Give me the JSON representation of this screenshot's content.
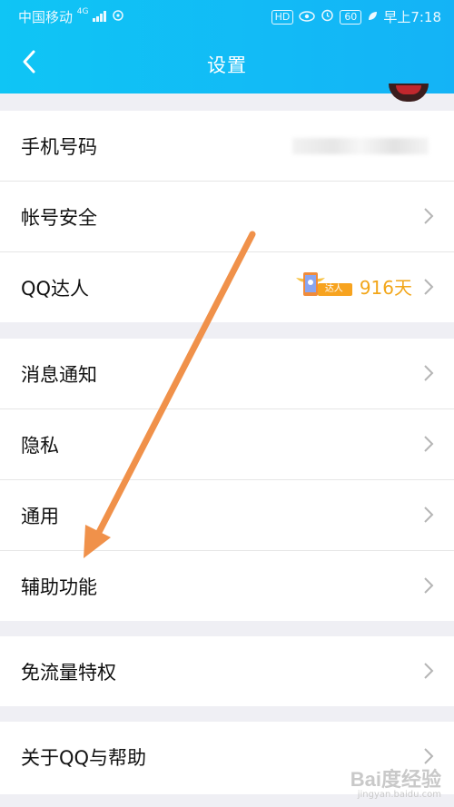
{
  "statusbar": {
    "carrier": "中国移动",
    "network": "4G",
    "hd": "HD",
    "battery": "60",
    "time": "早上7:18"
  },
  "header": {
    "title": "设置"
  },
  "group1": {
    "items": [
      {
        "label": "手机号码"
      },
      {
        "label": "帐号安全"
      },
      {
        "label": "QQ达人",
        "badge_text": "达人",
        "days": "916天"
      }
    ]
  },
  "group2": {
    "items": [
      {
        "label": "消息通知"
      },
      {
        "label": "隐私"
      },
      {
        "label": "通用"
      },
      {
        "label": "辅助功能"
      }
    ]
  },
  "group3": {
    "items": [
      {
        "label": "免流量特权"
      }
    ]
  },
  "group4": {
    "items": [
      {
        "label": "关于QQ与帮助"
      }
    ]
  },
  "watermark": {
    "logo": "Bai度经验",
    "url": "jingyan.baidu.com"
  },
  "colors": {
    "header": "#14b3f6",
    "accent_orange": "#f2a619",
    "annotation_arrow": "#f0914a"
  },
  "icons": [
    "back-chevron-icon",
    "chevron-right-icon",
    "talent-badge-icon"
  ]
}
